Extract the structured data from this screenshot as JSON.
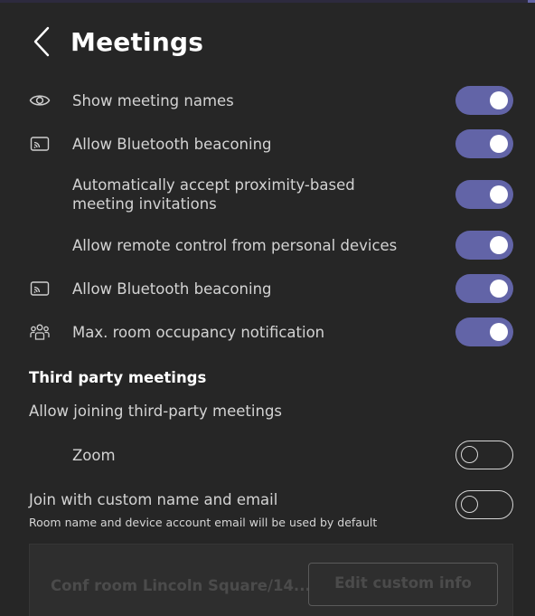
{
  "header": {
    "title": "Meetings"
  },
  "settings": [
    {
      "label": "Show meeting names",
      "icon": "eye-icon",
      "on": true
    },
    {
      "label": "Allow Bluetooth beaconing",
      "icon": "cast-icon",
      "on": true
    },
    {
      "label": "Automatically accept proximity-based meeting invitations",
      "icon": "",
      "on": true
    },
    {
      "label": "Allow remote control from personal devices",
      "icon": "",
      "on": true
    },
    {
      "label": "Allow Bluetooth beaconing",
      "icon": "cast-icon",
      "on": true
    },
    {
      "label": "Max. room occupancy notification",
      "icon": "people-group-icon",
      "on": true
    }
  ],
  "third_party": {
    "title": "Third party meetings",
    "allow_label": "Allow joining third-party meetings",
    "zoom_label": "Zoom",
    "zoom_on": false
  },
  "custom_identity": {
    "label": "Join with custom name and email",
    "on": false,
    "hint": "Room name and device account email will be used by default",
    "room_name": "Conf room Lincoln Square/14...",
    "edit_button": "Edit custom info"
  },
  "colors": {
    "accent": "#6264a7",
    "background": "#262626"
  }
}
